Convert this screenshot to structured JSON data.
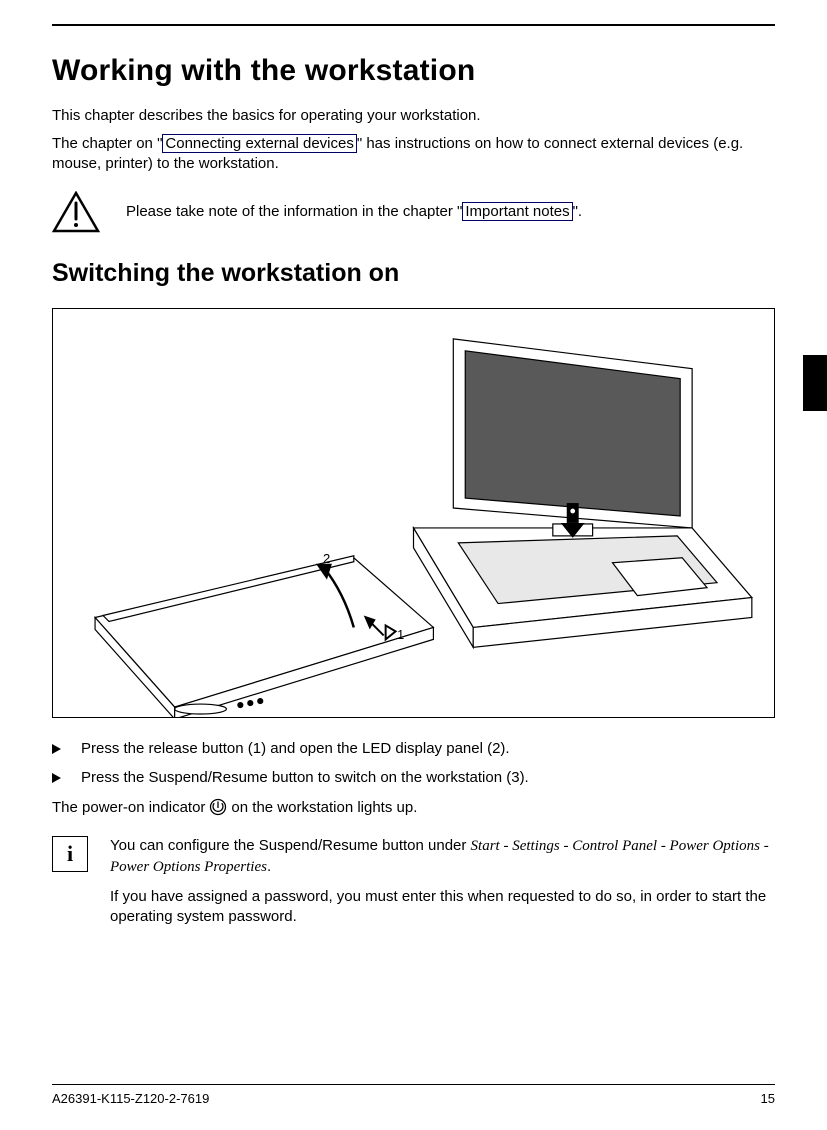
{
  "heading": "Working with the workstation",
  "intro1": "This chapter describes the basics for operating your workstation.",
  "intro2a": "The chapter on \"",
  "link1": "Connecting external devices",
  "intro2b": "\" has instructions on how to connect external devices (e.g. mouse, printer) to the workstation.",
  "warn_a": "Please take note of the information in the chapter \"",
  "warn_link": "Important notes",
  "warn_b": "\".",
  "sub": "Switching the workstation on",
  "step1": "Press the release button (1) and open the LED display panel (2).",
  "step2": "Press the Suspend/Resume button to switch on the workstation (3).",
  "power_a": "The power-on indicator",
  "power_b": "on the workstation lights up.",
  "info1a": "You can configure the Suspend/Resume button under ",
  "info1_ital": "Start - Settings - Control Panel - Power Options - Power Options Properties",
  "info1b": ".",
  "info2": "If you have assigned a password, you must enter this when requested to do so, in order to start the operating system password.",
  "doc_code": "A26391-K115-Z120-2-7619",
  "page_num": "15",
  "fig": {
    "label1": "1",
    "label2": "2"
  }
}
